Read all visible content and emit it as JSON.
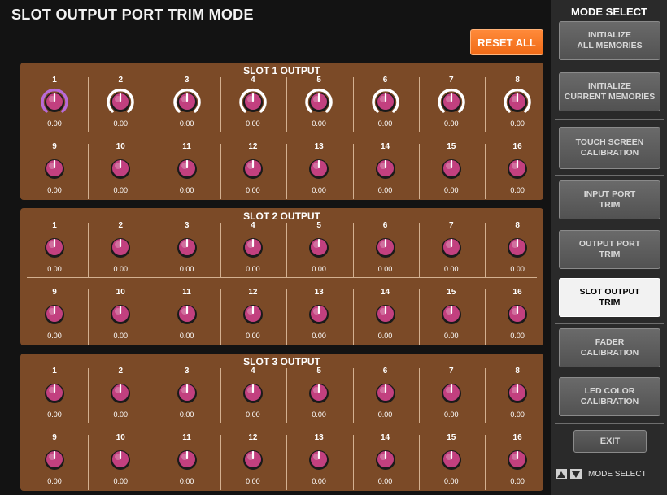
{
  "title": "SLOT OUTPUT PORT TRIM MODE",
  "reset_all": "RESET ALL",
  "slots": [
    {
      "title": "SLOT 1 OUTPUT",
      "channels": [
        {
          "num": "1",
          "value": "0.00",
          "ring": "purple"
        },
        {
          "num": "2",
          "value": "0.00",
          "ring": "white"
        },
        {
          "num": "3",
          "value": "0.00",
          "ring": "white"
        },
        {
          "num": "4",
          "value": "0.00",
          "ring": "white"
        },
        {
          "num": "5",
          "value": "0.00",
          "ring": "white"
        },
        {
          "num": "6",
          "value": "0.00",
          "ring": "white"
        },
        {
          "num": "7",
          "value": "0.00",
          "ring": "white"
        },
        {
          "num": "8",
          "value": "0.00",
          "ring": "white"
        },
        {
          "num": "9",
          "value": "0.00",
          "ring": "none"
        },
        {
          "num": "10",
          "value": "0.00",
          "ring": "none"
        },
        {
          "num": "11",
          "value": "0.00",
          "ring": "none"
        },
        {
          "num": "12",
          "value": "0.00",
          "ring": "none"
        },
        {
          "num": "13",
          "value": "0.00",
          "ring": "none"
        },
        {
          "num": "14",
          "value": "0.00",
          "ring": "none"
        },
        {
          "num": "15",
          "value": "0.00",
          "ring": "none"
        },
        {
          "num": "16",
          "value": "0.00",
          "ring": "none"
        }
      ]
    },
    {
      "title": "SLOT 2 OUTPUT",
      "channels": [
        {
          "num": "1",
          "value": "0.00",
          "ring": "none"
        },
        {
          "num": "2",
          "value": "0.00",
          "ring": "none"
        },
        {
          "num": "3",
          "value": "0.00",
          "ring": "none"
        },
        {
          "num": "4",
          "value": "0.00",
          "ring": "none"
        },
        {
          "num": "5",
          "value": "0.00",
          "ring": "none"
        },
        {
          "num": "6",
          "value": "0.00",
          "ring": "none"
        },
        {
          "num": "7",
          "value": "0.00",
          "ring": "none"
        },
        {
          "num": "8",
          "value": "0.00",
          "ring": "none"
        },
        {
          "num": "9",
          "value": "0.00",
          "ring": "none"
        },
        {
          "num": "10",
          "value": "0.00",
          "ring": "none"
        },
        {
          "num": "11",
          "value": "0.00",
          "ring": "none"
        },
        {
          "num": "12",
          "value": "0.00",
          "ring": "none"
        },
        {
          "num": "13",
          "value": "0.00",
          "ring": "none"
        },
        {
          "num": "14",
          "value": "0.00",
          "ring": "none"
        },
        {
          "num": "15",
          "value": "0.00",
          "ring": "none"
        },
        {
          "num": "16",
          "value": "0.00",
          "ring": "none"
        }
      ]
    },
    {
      "title": "SLOT 3 OUTPUT",
      "channels": [
        {
          "num": "1",
          "value": "0.00",
          "ring": "none"
        },
        {
          "num": "2",
          "value": "0.00",
          "ring": "none"
        },
        {
          "num": "3",
          "value": "0.00",
          "ring": "none"
        },
        {
          "num": "4",
          "value": "0.00",
          "ring": "none"
        },
        {
          "num": "5",
          "value": "0.00",
          "ring": "none"
        },
        {
          "num": "6",
          "value": "0.00",
          "ring": "none"
        },
        {
          "num": "7",
          "value": "0.00",
          "ring": "none"
        },
        {
          "num": "8",
          "value": "0.00",
          "ring": "none"
        },
        {
          "num": "9",
          "value": "0.00",
          "ring": "none"
        },
        {
          "num": "10",
          "value": "0.00",
          "ring": "none"
        },
        {
          "num": "11",
          "value": "0.00",
          "ring": "none"
        },
        {
          "num": "12",
          "value": "0.00",
          "ring": "none"
        },
        {
          "num": "13",
          "value": "0.00",
          "ring": "none"
        },
        {
          "num": "14",
          "value": "0.00",
          "ring": "none"
        },
        {
          "num": "15",
          "value": "0.00",
          "ring": "none"
        },
        {
          "num": "16",
          "value": "0.00",
          "ring": "none"
        }
      ]
    }
  ],
  "mode_select": {
    "title": "MODE SELECT",
    "buttons": [
      {
        "label": "INITIALIZE\nALL MEMORIES",
        "active": false
      },
      {
        "label": "INITIALIZE\nCURRENT MEMORIES",
        "active": false
      },
      {
        "label": "TOUCH SCREEN\nCALIBRATION",
        "active": false
      },
      {
        "label": "INPUT PORT\nTRIM",
        "active": false
      },
      {
        "label": "OUTPUT PORT\nTRIM",
        "active": false
      },
      {
        "label": "SLOT OUTPUT\nTRIM",
        "active": true
      },
      {
        "label": "FADER\nCALIBRATION",
        "active": false
      },
      {
        "label": "LED COLOR\nCALIBRATION",
        "active": false
      }
    ],
    "exit": "EXIT",
    "footer": "MODE SELECT",
    "footer_icons": [
      "up-arrow-icon",
      "down-arrow-icon"
    ]
  },
  "colors": {
    "panel": "#7b4a27",
    "knob": "#c2407f",
    "accent": "#f06a16",
    "selected_ring": "#b86ad8",
    "ring": "#ffffff"
  }
}
